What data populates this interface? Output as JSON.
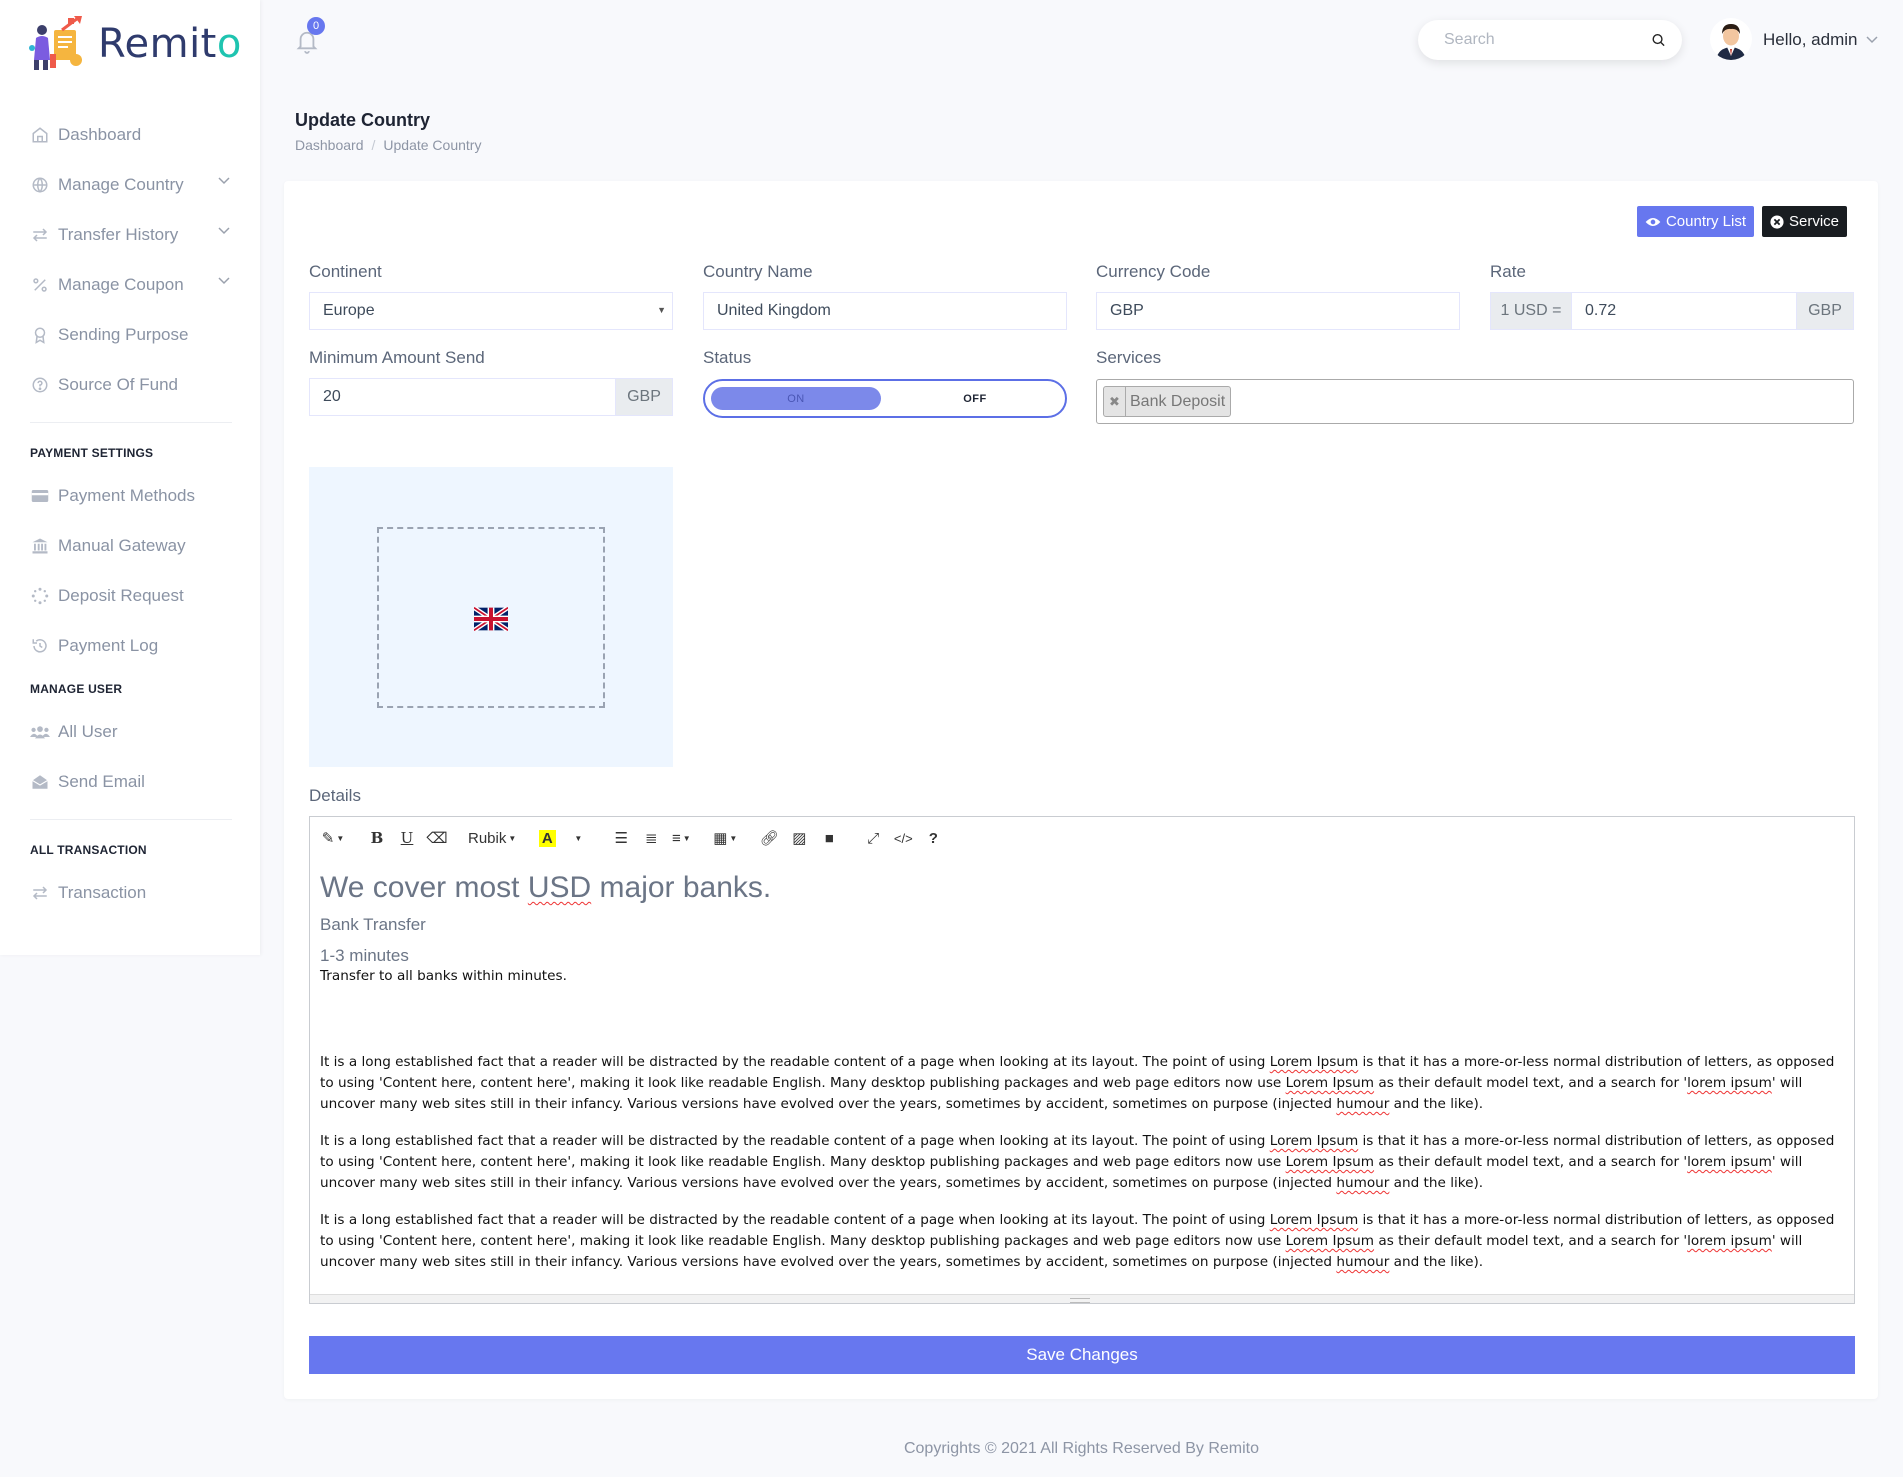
{
  "app": {
    "name_main": "Remit",
    "name_accent": "o"
  },
  "header": {
    "notification_count": "0",
    "search_placeholder": "Search",
    "greeting": "Hello, admin"
  },
  "sidebar": {
    "items": [
      {
        "label": "Dashboard",
        "icon": "home-icon"
      },
      {
        "label": "Manage Country",
        "icon": "globe-icon",
        "expandable": true
      },
      {
        "label": "Transfer History",
        "icon": "exchange-icon",
        "expandable": true
      },
      {
        "label": "Manage Coupon",
        "icon": "percent-icon",
        "expandable": true
      },
      {
        "label": "Sending Purpose",
        "icon": "award-icon"
      },
      {
        "label": "Source Of Fund",
        "icon": "question-icon"
      }
    ],
    "payment_heading": "PAYMENT SETTINGS",
    "payment_items": [
      {
        "label": "Payment Methods",
        "icon": "credit-card-icon"
      },
      {
        "label": "Manual Gateway",
        "icon": "bank-icon"
      },
      {
        "label": "Deposit Request",
        "icon": "spinner-icon"
      },
      {
        "label": "Payment Log",
        "icon": "history-icon"
      }
    ],
    "user_heading": "MANAGE USER",
    "user_items": [
      {
        "label": "All User",
        "icon": "users-icon"
      },
      {
        "label": "Send Email",
        "icon": "envelope-open-icon"
      }
    ],
    "transaction_heading": "ALL TRANSACTION",
    "transaction_items": [
      {
        "label": "Transaction",
        "icon": "exchange-icon"
      }
    ]
  },
  "page": {
    "title": "Update Country",
    "breadcrumb": [
      "Dashboard",
      "Update Country"
    ]
  },
  "actions": {
    "country_list": "Country List",
    "service": "Service"
  },
  "form": {
    "continent_label": "Continent",
    "continent_value": "Europe",
    "country_name_label": "Country Name",
    "country_name_value": "United Kingdom",
    "currency_code_label": "Currency Code",
    "currency_code_value": "GBP",
    "rate_label": "Rate",
    "rate_prefix": "1 USD =",
    "rate_value": "0.72",
    "rate_suffix": "GBP",
    "min_amount_label": "Minimum Amount Send",
    "min_amount_value": "20",
    "min_amount_suffix": "GBP",
    "status_label": "Status",
    "status_on": "ON",
    "status_off": "OFF",
    "services_label": "Services",
    "services_selected": [
      "Bank Deposit"
    ],
    "details_label": "Details",
    "save_label": "Save Changes"
  },
  "editor": {
    "font_name": "Rubik",
    "heading_pre": "We cover most ",
    "heading_sq": "USD",
    "heading_post": " major banks.",
    "subheading": "Bank Transfer",
    "time": "1-3 minutes",
    "tagline": "Transfer to all banks within minutes.",
    "paragraph": {
      "p1": "It is a long established fact that a reader will be distracted by the readable content of a page when looking at its layout. The point of using ",
      "w1": "Lorem Ipsum",
      "p2": " is that it has a more-or-less normal distribution of letters, as opposed to using 'Content here, content here', making it look like readable English. Many desktop publishing packages and web page editors now use ",
      "w2": "Lorem Ipsum",
      "p3": " as their default model text, and a search for '",
      "w3": "lorem ipsum",
      "p4": "' will uncover many web sites still in their infancy. Various versions have evolved over the years, sometimes by accident, sometimes on purpose (injected ",
      "w4": "humour",
      "p5": " and the like)."
    }
  },
  "footer": {
    "text": "Copyrights © 2021 All Rights Reserved By Remito"
  },
  "colors": {
    "primary": "#6777ef",
    "dark": "#191d21",
    "accent": "#1fc4b0"
  }
}
